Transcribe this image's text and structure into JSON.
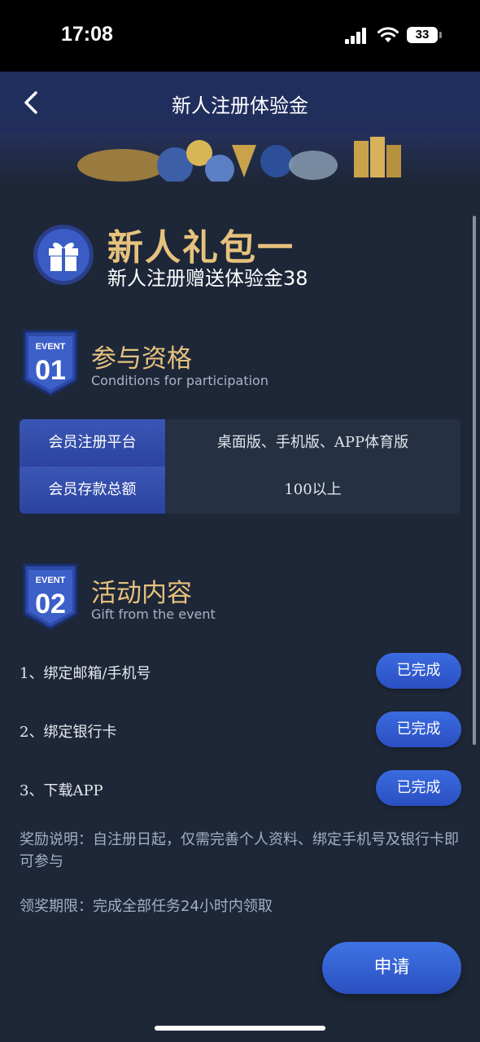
{
  "status_bar": {
    "time": "17:08",
    "battery": "33"
  },
  "header": {
    "title": "新人注册体验金"
  },
  "package": {
    "title": "新人礼包一",
    "subtitle": "新人注册赠送体验金38"
  },
  "sections": [
    {
      "badge_top": "EVENT",
      "badge_num": "01",
      "title": "参与资格",
      "subtitle": "Conditions for participation"
    },
    {
      "badge_top": "EVENT",
      "badge_num": "02",
      "title": "活动内容",
      "subtitle": "Gift from the event"
    }
  ],
  "conditions": [
    {
      "label": "会员注册平台",
      "value": "桌面版、手机版、APP体育版"
    },
    {
      "label": "会员存款总额",
      "value": "100以上"
    }
  ],
  "tasks": [
    {
      "label": "1、绑定邮箱/手机号",
      "status": "已完成"
    },
    {
      "label": "2、绑定银行卡",
      "status": "已完成"
    },
    {
      "label": "3、下载APP",
      "status": "已完成"
    }
  ],
  "notes": {
    "reward": "奖励说明：自注册日起，仅需完善个人资料、绑定手机号及银行卡即可参与",
    "deadline": "领奖期限：完成全部任务24小时内领取"
  },
  "apply_button": "申请",
  "colors": {
    "accent_gold": "#e6c27c",
    "button_blue": "#2f5bd0",
    "background": "#1e2738"
  }
}
